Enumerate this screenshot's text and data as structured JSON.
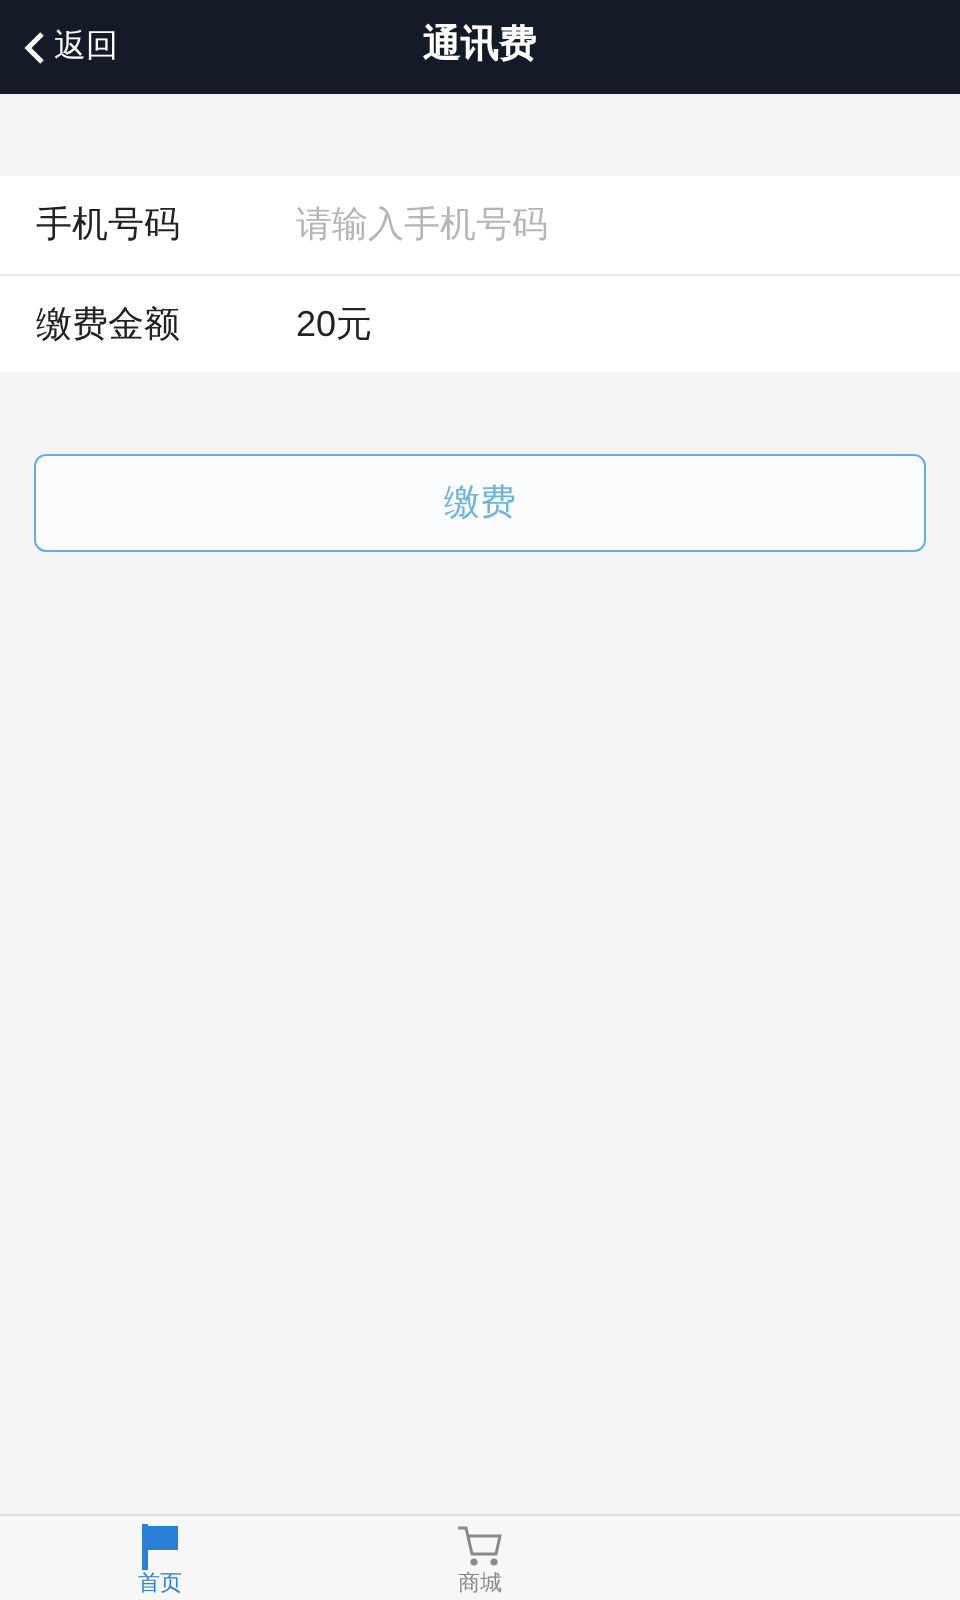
{
  "header": {
    "back": "返回",
    "title": "通讯费"
  },
  "form": [
    {
      "label": "手机号码",
      "placeholder": "请输入手机号码"
    },
    {
      "label": "缴费金额",
      "value": "20元"
    }
  ],
  "submit": "缴费",
  "tabs": [
    {
      "label": "首页",
      "kind": "flag",
      "selected": true
    },
    {
      "label": "商城",
      "kind": "cart",
      "selected": false
    }
  ]
}
